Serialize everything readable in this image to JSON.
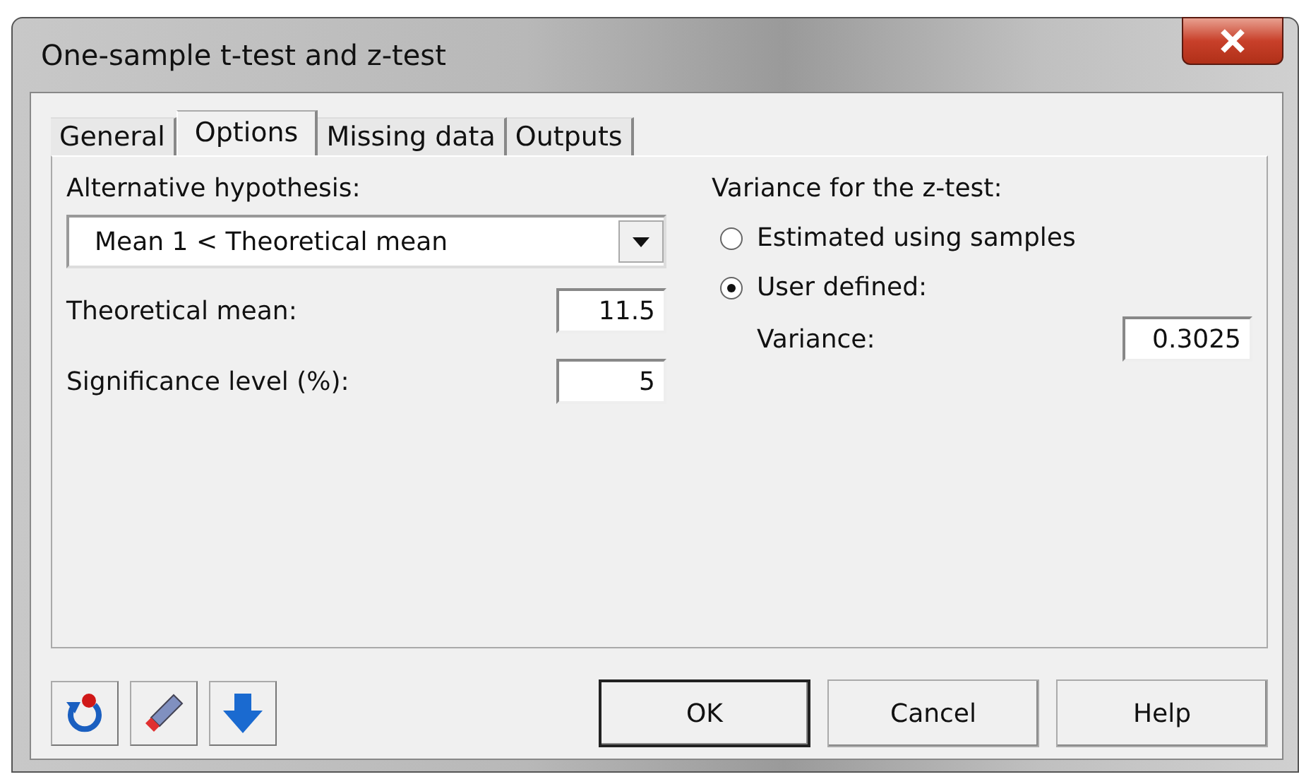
{
  "window": {
    "title": "One-sample t-test and z-test"
  },
  "tabs": [
    {
      "label": "General",
      "selected": false
    },
    {
      "label": "Options",
      "selected": true
    },
    {
      "label": "Missing data",
      "selected": false
    },
    {
      "label": "Outputs",
      "selected": false
    }
  ],
  "alternative": {
    "label": "Alternative hypothesis:",
    "value": "Mean 1 < Theoretical mean"
  },
  "fields": [
    {
      "label": "Theoretical mean:",
      "value": "11.5"
    },
    {
      "label": "Significance level (%):",
      "value": "5"
    }
  ],
  "variance": {
    "label": "Variance for the z-test:",
    "options": [
      {
        "label": "Estimated using samples",
        "selected": false
      },
      {
        "label": "User defined:",
        "selected": true
      }
    ],
    "field": {
      "label": "Variance:",
      "value": "0.3025"
    }
  },
  "tools": [
    {
      "kind": "reset"
    },
    {
      "kind": "eraser"
    },
    {
      "kind": "down"
    }
  ],
  "buttons": [
    {
      "label": "OK",
      "default": true
    },
    {
      "label": "Cancel",
      "default": false
    },
    {
      "label": "Help",
      "default": false
    }
  ]
}
